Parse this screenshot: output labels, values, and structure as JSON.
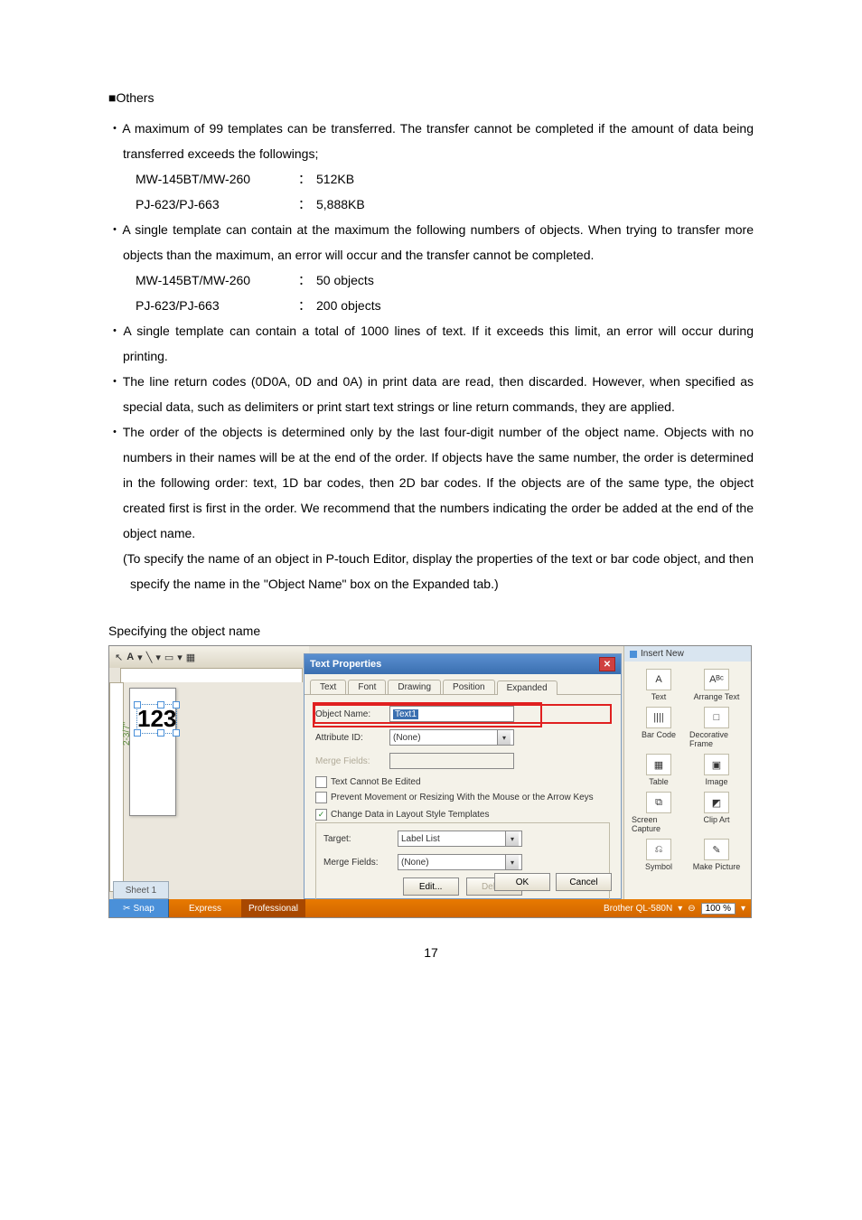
{
  "heading": "■Others",
  "bullets": [
    "・A maximum of 99 templates can be transferred. The transfer cannot be completed if the amount of data being transferred exceeds the followings;",
    "・A single template can contain at the maximum the following numbers of objects. When trying to transfer more objects than the maximum, an error will occur and the transfer cannot be completed.",
    "・A single template can contain a total of 1000 lines of text. If it exceeds this limit, an error will occur during printing.",
    "・The line return codes (0D0A, 0D and 0A) in print data are read, then discarded. However, when specified as special data, such as delimiters or print start text strings or line return commands, they are applied.",
    "・The order of the objects is determined only by the last four-digit number of the object name. Objects with no numbers in their names will be at the end of the order. If objects have the same number, the order is determined in the following order: text, 1D bar codes, then 2D bar codes. If the objects are of the same type, the object created first is first in the order. We recommend that the numbers indicating the order be added at the end of the object name."
  ],
  "note": "(To specify the name of an object in P-touch Editor, display the properties of the text or bar code object, and then specify the name in the \"Object Name\" box on the Expanded tab.)",
  "table1": [
    {
      "model": "MW-145BT/MW-260",
      "value": "512KB"
    },
    {
      "model": "PJ-623/PJ-663",
      "value": "5,888KB"
    }
  ],
  "table2": [
    {
      "model": "MW-145BT/MW-260",
      "value": "50 objects"
    },
    {
      "model": "PJ-623/PJ-663",
      "value": "200 objects"
    }
  ],
  "caption": "Specifying the object name",
  "screenshot": {
    "toolbar_text": "A",
    "label_text": "123",
    "dimension": "2-3/7\"",
    "sheet_tab": "Sheet 1",
    "bottom": {
      "snap": "Snap",
      "express": "Express",
      "professional": "Professional",
      "printer": "Brother QL-580N",
      "zoom": "100 %"
    },
    "dialog": {
      "title": "Text Properties",
      "tabs": [
        "Text",
        "Font",
        "Drawing",
        "Position",
        "Expanded"
      ],
      "object_name_label": "Object Name:",
      "object_name_value": "Text1",
      "attr_id_label": "Attribute ID:",
      "attr_id_value": "(None)",
      "merge_fields_top": "Merge Fields:",
      "cb_readonly": "Text Cannot Be Edited",
      "cb_prevent": "Prevent Movement or Resizing With the Mouse or the Arrow Keys",
      "fieldset_legend": "Change Data in Layout Style Templates",
      "target_label": "Target:",
      "target_value": "Label List",
      "merge_fields_label": "Merge Fields:",
      "merge_fields_value": "(None)",
      "edit_btn": "Edit...",
      "delete_btn": "Delete",
      "ok": "OK",
      "cancel": "Cancel"
    },
    "insert_panel": {
      "header": "Insert New",
      "items": [
        {
          "label": "Text",
          "glyph": "A"
        },
        {
          "label": "Arrange Text",
          "glyph": "Aᴮᶜ"
        },
        {
          "label": "Bar Code",
          "glyph": "||||"
        },
        {
          "label": "Decorative Frame",
          "glyph": "□"
        },
        {
          "label": "Table",
          "glyph": "▦"
        },
        {
          "label": "Image",
          "glyph": "▣"
        },
        {
          "label": "Screen Capture",
          "glyph": "⧉"
        },
        {
          "label": "Clip Art",
          "glyph": "◩"
        },
        {
          "label": "Symbol",
          "glyph": "⎌"
        },
        {
          "label": "Make Picture",
          "glyph": "✎"
        }
      ]
    }
  },
  "page_number": "17"
}
